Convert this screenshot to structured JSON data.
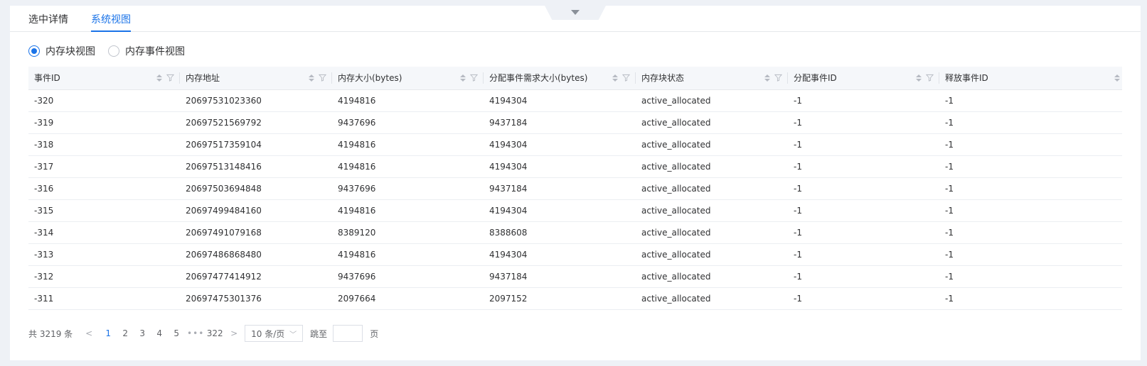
{
  "tabs": [
    {
      "label": "选中详情",
      "active": false
    },
    {
      "label": "系统视图",
      "active": true
    }
  ],
  "view_modes": [
    {
      "label": "内存块视图",
      "checked": true
    },
    {
      "label": "内存事件视图",
      "checked": false
    }
  ],
  "table": {
    "columns": [
      "事件ID",
      "内存地址",
      "内存大小(bytes)",
      "分配事件需求大小(bytes)",
      "内存块状态",
      "分配事件ID",
      "释放事件ID"
    ],
    "rows": [
      [
        "-320",
        "20697531023360",
        "4194816",
        "4194304",
        "active_allocated",
        "-1",
        "-1"
      ],
      [
        "-319",
        "20697521569792",
        "9437696",
        "9437184",
        "active_allocated",
        "-1",
        "-1"
      ],
      [
        "-318",
        "20697517359104",
        "4194816",
        "4194304",
        "active_allocated",
        "-1",
        "-1"
      ],
      [
        "-317",
        "20697513148416",
        "4194816",
        "4194304",
        "active_allocated",
        "-1",
        "-1"
      ],
      [
        "-316",
        "20697503694848",
        "9437696",
        "9437184",
        "active_allocated",
        "-1",
        "-1"
      ],
      [
        "-315",
        "20697499484160",
        "4194816",
        "4194304",
        "active_allocated",
        "-1",
        "-1"
      ],
      [
        "-314",
        "20697491079168",
        "8389120",
        "8388608",
        "active_allocated",
        "-1",
        "-1"
      ],
      [
        "-313",
        "20697486868480",
        "4194816",
        "4194304",
        "active_allocated",
        "-1",
        "-1"
      ],
      [
        "-312",
        "20697477414912",
        "9437696",
        "9437184",
        "active_allocated",
        "-1",
        "-1"
      ],
      [
        "-311",
        "20697475301376",
        "2097664",
        "2097152",
        "active_allocated",
        "-1",
        "-1"
      ]
    ]
  },
  "pagination": {
    "total_text": "共 3219 条",
    "prev_icon": "chevron-left-icon",
    "next_icon": "chevron-right-icon",
    "pages": [
      "1",
      "2",
      "3",
      "4",
      "5"
    ],
    "active_page": "1",
    "ellipsis": "•••",
    "last_page": "322",
    "page_size": "10 条/页",
    "goto_label": "跳至",
    "goto_value": "",
    "goto_unit": "页"
  },
  "colors": {
    "accent": "#1a73e8",
    "header_bg": "#f5f7fa",
    "page_bg": "#eef1f6"
  }
}
